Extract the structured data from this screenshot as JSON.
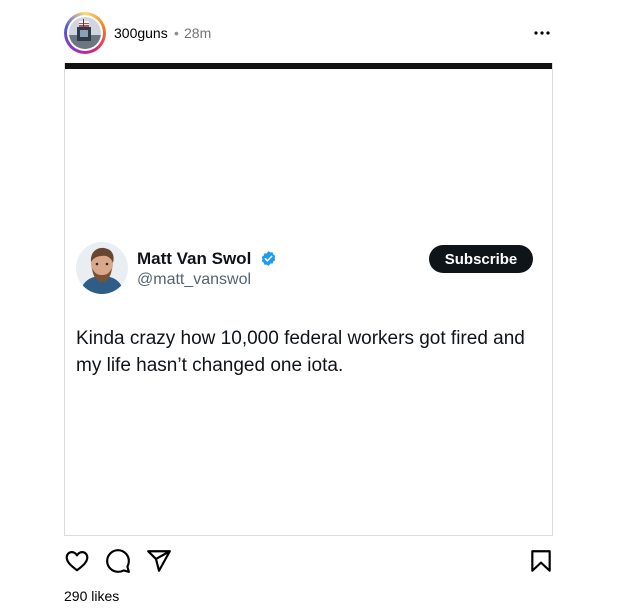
{
  "post": {
    "username": "300guns",
    "separator": "•",
    "time": "28m",
    "likes": "290 likes"
  },
  "tweet": {
    "name": "Matt Van Swol",
    "handle": "@matt_vanswol",
    "subscribe_label": "Subscribe",
    "text": "Kinda crazy how 10,000 federal workers got fired and my life hasn’t changed one iota."
  },
  "icons": {
    "more": "more-horizontal-icon",
    "like": "heart-icon",
    "comment": "comment-icon",
    "share": "share-icon",
    "save": "bookmark-icon",
    "verified": "verified-badge-icon"
  },
  "colors": {
    "verified_blue": "#1d9bf0",
    "subscribe_bg": "#0f1419",
    "media_topbar": "#111111"
  }
}
